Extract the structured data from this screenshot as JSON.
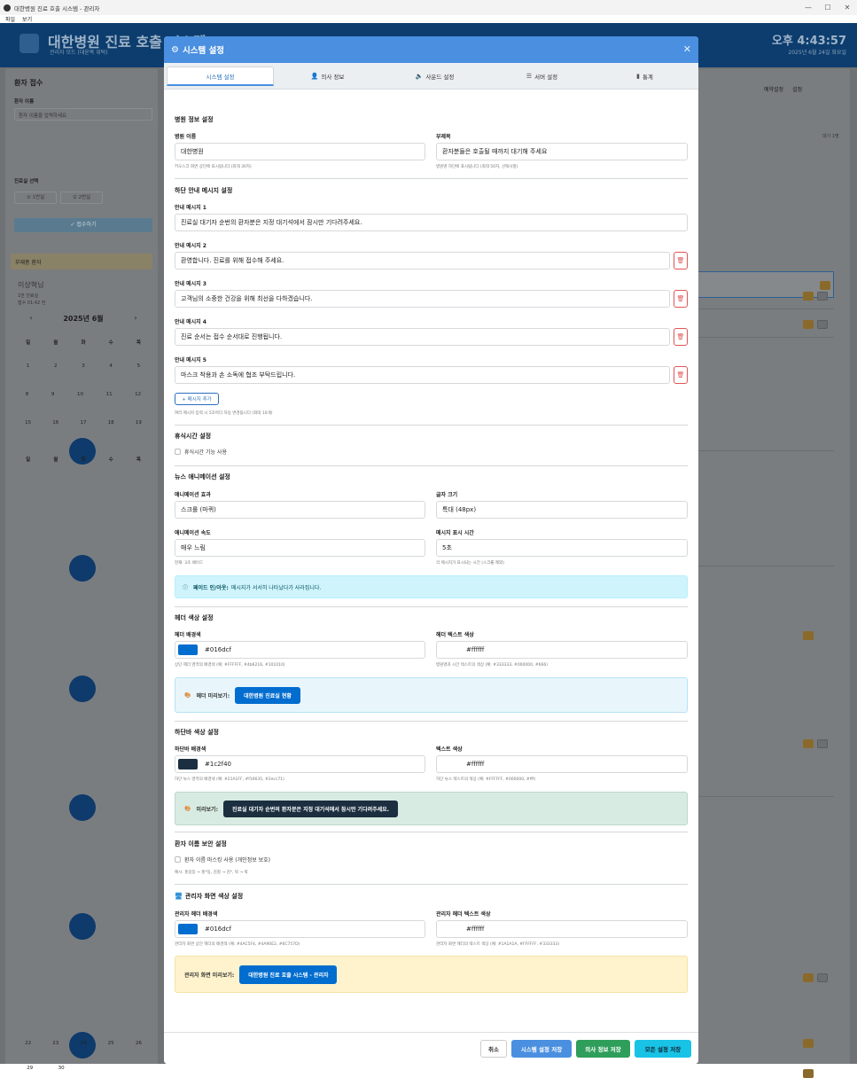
{
  "window": {
    "title": "대한병원 진료 호출 시스템 - 관리자",
    "menu": [
      "파일",
      "보기"
    ],
    "controls": {
      "minimize": "—",
      "maximize": "☐",
      "close": "✕"
    }
  },
  "background": {
    "title": "대한병원 진료 호출 시스템",
    "subtitle": "관리자 모드 (대윤복 위탁)",
    "time": "오후 4:43:57",
    "date": "2025년 6월 24일 화요일",
    "left": {
      "heading": "환자 접수",
      "name_label": "환자 이름",
      "name_placeholder": "환자 이름을 입력하세요",
      "room_label": "진료실 선택",
      "room_buttons": [
        "① 1번실",
        "② 2번실"
      ],
      "submit": "✓ 접수하기",
      "absent": "부재중 환자",
      "patient_name": "이상혁님",
      "patient_room": "1번 진료실",
      "patient_time": "접수 01:42 전",
      "calendar_title": "2025년 6월",
      "weekdays": [
        "일",
        "월",
        "화",
        "수",
        "목"
      ],
      "prev_arrow": "‹",
      "next_arrow": "›",
      "cal_weeks": [
        [
          "1",
          "2",
          "3",
          "4",
          "5"
        ],
        [
          "8",
          "9",
          "10",
          "11",
          "12"
        ],
        [
          "15",
          "16",
          "17",
          "18",
          "19"
        ],
        [
          "22",
          "23",
          "24",
          "25",
          "26"
        ],
        [
          "29",
          "30",
          "",
          "",
          ""
        ]
      ]
    },
    "right": {
      "tools": [
        "예약설정",
        "설정"
      ],
      "count": "대기 1명"
    }
  },
  "modal": {
    "title": "시스템 설정",
    "close": "✕",
    "tabs": [
      {
        "icon": "⚙",
        "label": "시스템 설정"
      },
      {
        "icon": "👤",
        "label": "의사 정보"
      },
      {
        "icon": "🔈",
        "label": "사운드 설정"
      },
      {
        "icon": "☰",
        "label": "서버 설정"
      },
      {
        "icon": "▮",
        "label": "통계"
      }
    ],
    "hospital": {
      "section": "병원 정보 설정",
      "name_label": "병원 이름",
      "name_value": "대한병원",
      "name_help": "키오스크 화면 상단에 표시됩니다 (최대 30자)",
      "sub_label": "부제목",
      "sub_value": "환자분들은 호출될 때까지 대기해 주세요",
      "sub_help": "병원명 하단에 표시됩니다 (최대 50자, 선택사항)"
    },
    "messages": {
      "section": "하단 안내 메시지 설정",
      "items": [
        {
          "label": "안내 메시지 1",
          "value": "진료실 대기자 순번의 환자분은 지정 대기석에서 잠시만 기다려주세요."
        },
        {
          "label": "안내 메시지 2",
          "value": "환영합니다. 진료를 위해 접수해 주세요."
        },
        {
          "label": "안내 메시지 3",
          "value": "고객님의 소중한 건강을 위해 최선을 다하겠습니다."
        },
        {
          "label": "안내 메시지 4",
          "value": "진료 순서는 접수 순서대로 진행됩니다."
        },
        {
          "label": "안내 메시지 5",
          "value": "마스크 착용과 손 소독에 협조 부탁드립니다."
        }
      ],
      "delete_icon": "🗑",
      "add_button": "+ 메시지 추가",
      "help": "여러 메시지 입력 시 5초마다 자동 변경됩니다 (최대 10개)"
    },
    "rest": {
      "section": "휴식시간 설정",
      "checkbox": "휴식시간 기능 사용"
    },
    "news": {
      "section": "뉴스 애니메이션 설정",
      "effect_label": "애니메이션 효과",
      "effect_value": "스크롤 (마퀴)",
      "font_label": "글자 크기",
      "font_value": "특대 (48px)",
      "speed_label": "애니메이션 속도",
      "speed_value": "매우 느림",
      "speed_help": "현재: 3초 페이드",
      "time_label": "메시지 표시 시간",
      "time_value": "5초",
      "time_help": "각 메시지가 표시되는 시간 (스크롤 제외)",
      "info_icon": "ⓘ",
      "info_bold": "페이드 인/아웃:",
      "info_text": "메시지가 서서히 나타났다가 사라집니다."
    },
    "header_colors": {
      "section": "헤더 색상 설정",
      "bg_label": "헤더 배경색",
      "bg_value": "#016dcf",
      "bg_color": "#016dcf",
      "bg_help": "상단 헤더 영역의 배경색 (예: #FFFFFF, #4b6216, #101010)",
      "text_label": "헤더 텍스트 색상",
      "text_value": "#ffffff",
      "text_color": "#ffffff",
      "text_help": "병원명과 시간 텍스트의 색상 (예: #333333, #000000, #666)",
      "preview_icon": "🎨",
      "preview_label": "헤더 미리보기:",
      "preview_text": "대한병원 진료실 현황",
      "preview_bg": "#e8f6fc"
    },
    "footer_colors": {
      "section": "하단바 색상 설정",
      "bg_label": "하단바 배경색",
      "bg_value": "#1c2f40",
      "bg_color": "#1c2f40",
      "bg_help": "하단 뉴스 영역의 배경색 (예: #21A1FF, #f16635, #2ecc71)",
      "text_label": "텍스트 색상",
      "text_value": "#ffffff",
      "text_color": "#ffffff",
      "text_help": "하단 뉴스 텍스트의 색상 (예: #FFFFFF, #000000, #fff)",
      "preview_icon": "🎨",
      "preview_label": "미리보기:",
      "preview_text": "진료실 대기자 순번의 환자분은 지정 대기석에서 잠시만 기다려주세요.",
      "preview_bg": "#d8ebe2"
    },
    "privacy": {
      "section": "환자 이름 보안 설정",
      "checkbox": "환자 이름 마스킹 사용 (개인정보 보호)",
      "help": "예시: 홍길동 → 홍*동, 김철 → 김*, 박 → 박"
    },
    "admin_colors": {
      "section_icon": "🖥",
      "section": "관리자 화면 색상 설정",
      "bg_label": "관리자 헤더 배경색",
      "bg_value": "#016dcf",
      "bg_color": "#016dcf",
      "bg_help": "관리자 화면 상단 헤더의 배경색 (예: #4AC5F4, #4A90E2, #6C757D)",
      "text_label": "관리자 헤더 텍스트 색상",
      "text_value": "#ffffff",
      "text_color": "#ffffff",
      "text_help": "관리자 화면 헤더의 텍스트 색상 (예: #1A1A1A, #FFFFFF, #333333)",
      "preview_label": "관리자 화면 미리보기:",
      "preview_text": "대한병원 진료 호출 시스템 - 관리자",
      "preview_bg": "#fff3cd"
    },
    "footer": {
      "cancel": "취소",
      "save_system": "시스템 설정 저장",
      "save_doctor": "의사 정보 저장",
      "save_all": "모든 설정 저장"
    }
  }
}
